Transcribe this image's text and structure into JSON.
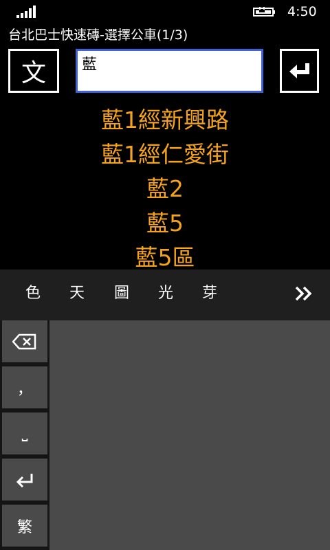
{
  "status_bar": {
    "time": "4:50",
    "icons": [
      "signal-icon",
      "battery-charging-icon"
    ]
  },
  "app": {
    "title": "台北巴士快速磚-選擇公車(1/3)"
  },
  "controls": {
    "mode_label": "文",
    "search_value": "藍",
    "enter_icon": "enter-arrow-icon"
  },
  "results": [
    "藍1經新興路",
    "藍1經仁愛街",
    "藍2",
    "藍5",
    "藍5區"
  ],
  "keyboard": {
    "candidates": [
      "色",
      "天",
      "圖",
      "光",
      "芽"
    ],
    "more_icon": "double-chevron-right-icon",
    "side_keys": {
      "backspace_icon": "backspace-icon",
      "comma": "，",
      "space": "⎵",
      "enter_icon": "enter-arrow-icon",
      "traditional": "繁"
    }
  },
  "colors": {
    "result_text": "#f5a31a",
    "input_border": "#3e63d6",
    "key_bg": "#4a4a4a"
  }
}
